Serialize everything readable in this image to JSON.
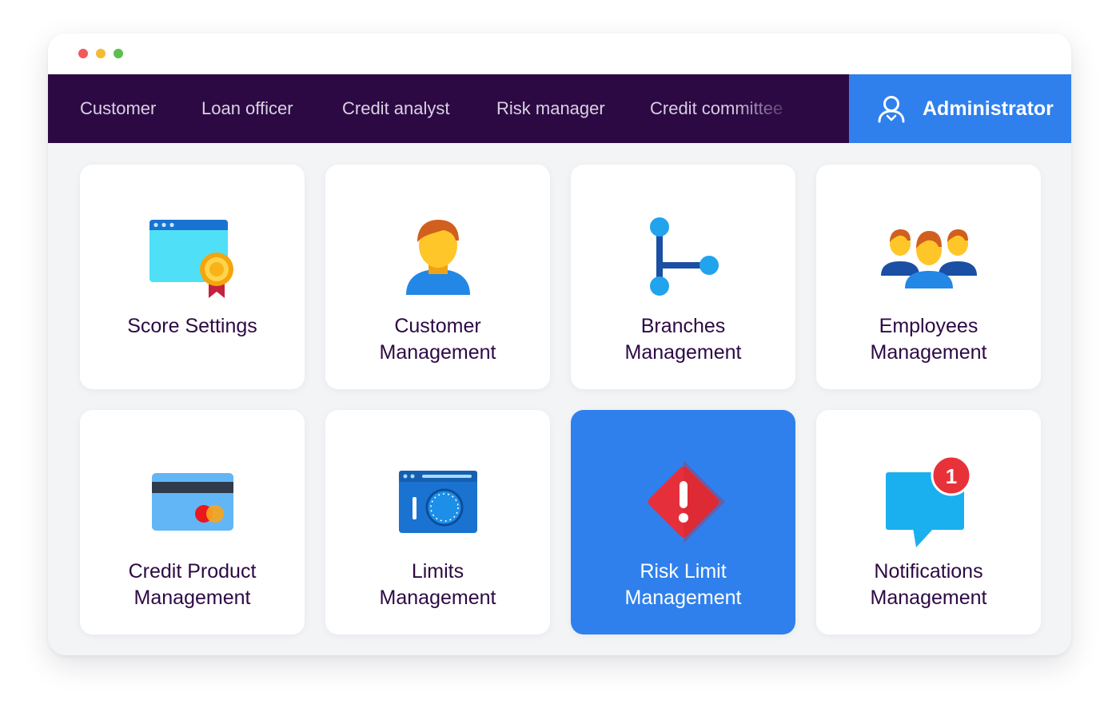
{
  "nav": {
    "items": [
      "Customer",
      "Loan officer",
      "Credit analyst",
      "Risk manager",
      "Credit committee"
    ],
    "admin_label": "Administrator"
  },
  "tiles": [
    {
      "lines": [
        "Score Settings"
      ],
      "icon": "certificate-icon"
    },
    {
      "lines": [
        "Customer",
        "Management"
      ],
      "icon": "user-icon"
    },
    {
      "lines": [
        "Branches",
        "Management"
      ],
      "icon": "branches-icon"
    },
    {
      "lines": [
        "Employees",
        "Management"
      ],
      "icon": "employees-icon"
    },
    {
      "lines": [
        "Credit Product",
        "Management"
      ],
      "icon": "credit-card-icon"
    },
    {
      "lines": [
        "Limits",
        "Management"
      ],
      "icon": "limits-icon"
    },
    {
      "lines": [
        "Risk Limit",
        "Management"
      ],
      "icon": "warning-icon",
      "active": true
    },
    {
      "lines": [
        "Notifications",
        "Management"
      ],
      "icon": "notification-icon",
      "badge": "1"
    }
  ],
  "colors": {
    "nav_bg": "#2d0944",
    "accent": "#2f80ed",
    "text": "#2d0944",
    "badge": "#e8323a"
  }
}
